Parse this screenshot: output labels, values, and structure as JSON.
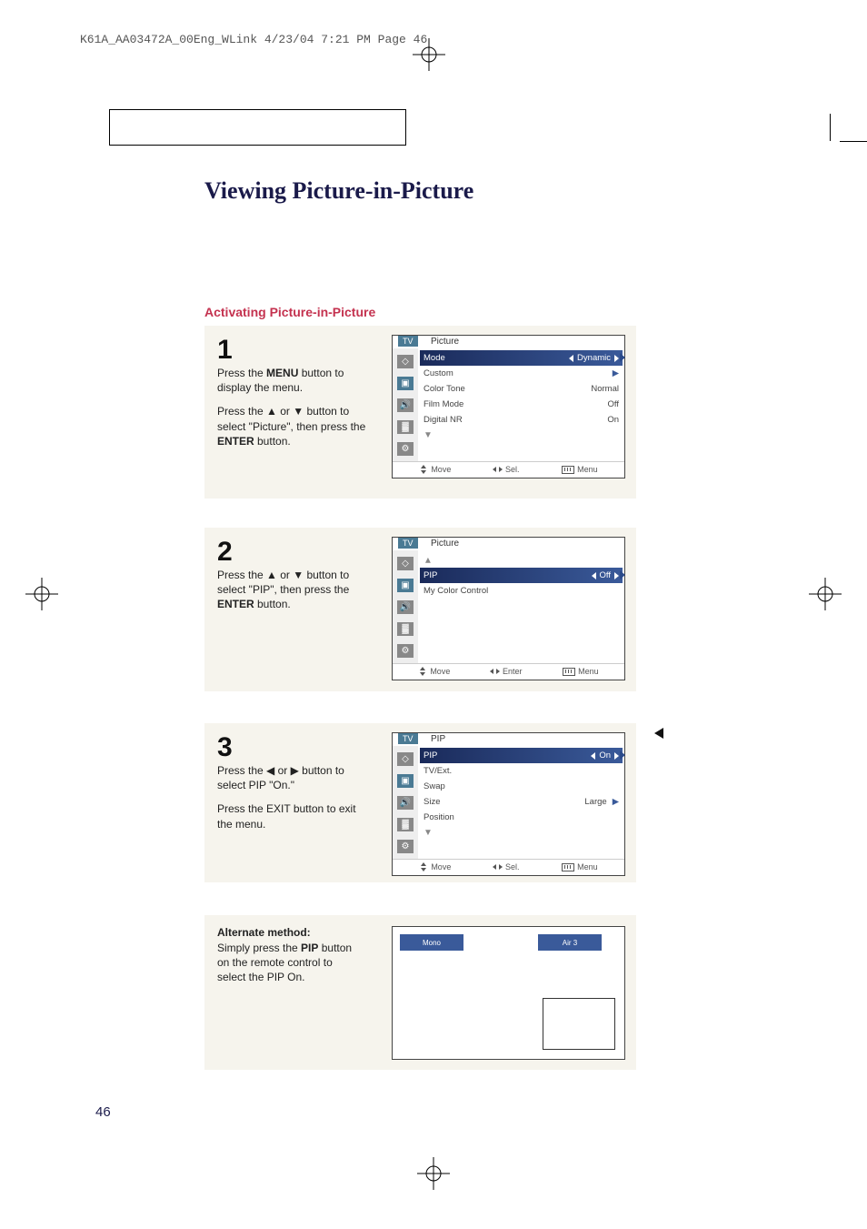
{
  "header": {
    "jobline": "K61A_AA03472A_00Eng_WLink  4/23/04  7:21 PM  Page 46"
  },
  "title": "Viewing Picture-in-Picture",
  "section": "Activating Picture-in-Picture",
  "steps": {
    "s1": {
      "num": "1",
      "p1a": "Press the ",
      "p1b": "MENU",
      "p1c": " button to display the menu.",
      "p2a": "Press the ▲ or ▼ button to select \"Picture\", then press the ",
      "p2b": "ENTER",
      "p2c": " button."
    },
    "s2": {
      "num": "2",
      "p1a": "Press the ▲ or ▼ button to select \"PIP\", then press the ",
      "p1b": "ENTER",
      "p1c": " button."
    },
    "s3": {
      "num": "3",
      "p1": "Press the ◀ or ▶ button to select PIP \"On.\"",
      "p2": "Press the EXIT button to exit the menu."
    }
  },
  "alt": {
    "head": "Alternate method:",
    "p1a": "Simply press the ",
    "p1b": "PIP",
    "p1c": " button on the remote control to select the PIP On."
  },
  "menus": {
    "tvlabel": "TV",
    "m1": {
      "title": "Picture",
      "rows": {
        "mode": {
          "label": "Mode",
          "value": "Dynamic"
        },
        "custom": {
          "label": "Custom"
        },
        "colortone": {
          "label": "Color Tone",
          "value": "Normal"
        },
        "filmmode": {
          "label": "Film Mode",
          "value": "Off"
        },
        "dnr": {
          "label": "Digital NR",
          "value": "On"
        },
        "move": "Move",
        "sel": "Sel.",
        "menu": "Menu"
      }
    },
    "m2": {
      "title": "Picture",
      "rows": {
        "pip": {
          "label": "PIP",
          "value": "Off"
        },
        "mychannel": {
          "label": "My Color Control"
        },
        "move": "Move",
        "enter": "Enter",
        "menu": "Menu"
      }
    },
    "m3": {
      "title": "PIP",
      "rows": {
        "pip": {
          "label": "PIP",
          "value": "On"
        },
        "tvext": {
          "label": "TV/Ext."
        },
        "swap": {
          "label": "Swap"
        },
        "size": {
          "label": "Size",
          "value": "Large"
        },
        "position": {
          "label": "Position"
        },
        "move": "Move",
        "sel": "Sel.",
        "menu": "Menu"
      }
    },
    "alt_screen": {
      "main": "Mono",
      "pip": "Air 3"
    }
  },
  "page_number": "46"
}
